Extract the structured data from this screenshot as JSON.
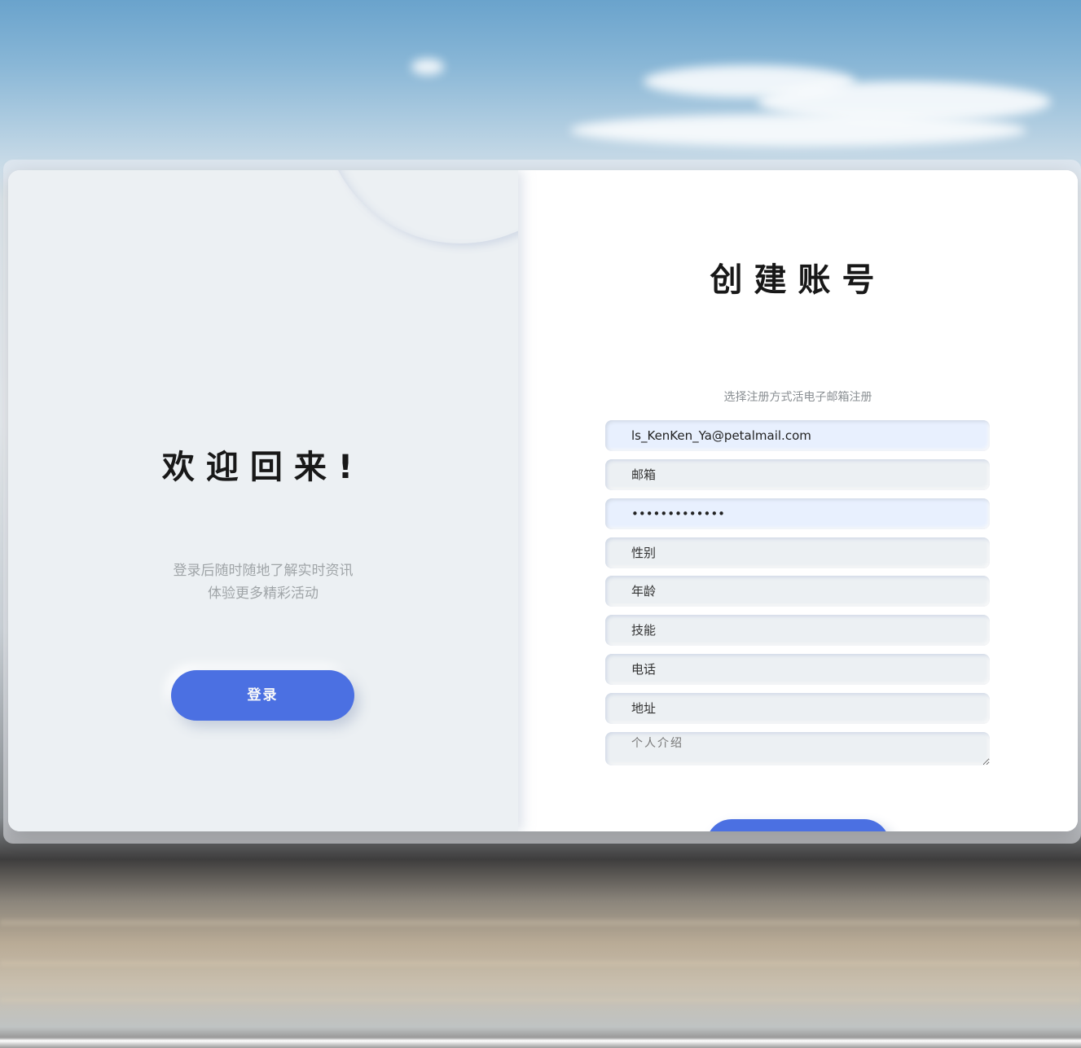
{
  "left_panel": {
    "title": "欢迎回来!",
    "description_line1": "登录后随时随地了解实时资讯",
    "description_line2": "体验更多精彩活动",
    "login_button": "登录"
  },
  "right_panel": {
    "title": "创建账号",
    "hint": "选择注册方式活电子邮箱注册",
    "fields": {
      "username_value": "ls_KenKen_Ya@petalmail.com",
      "email_placeholder": "邮箱",
      "password_value": "•••••••••••••",
      "gender_placeholder": "性别",
      "age_placeholder": "年龄",
      "skills_placeholder": "技能",
      "phone_placeholder": "电话",
      "address_placeholder": "地址",
      "bio_placeholder": "个人介绍"
    }
  },
  "colors": {
    "accent": "#4b70e2",
    "panel_bg": "#ecf0f3",
    "autofill_bg": "#e8f0fe"
  }
}
